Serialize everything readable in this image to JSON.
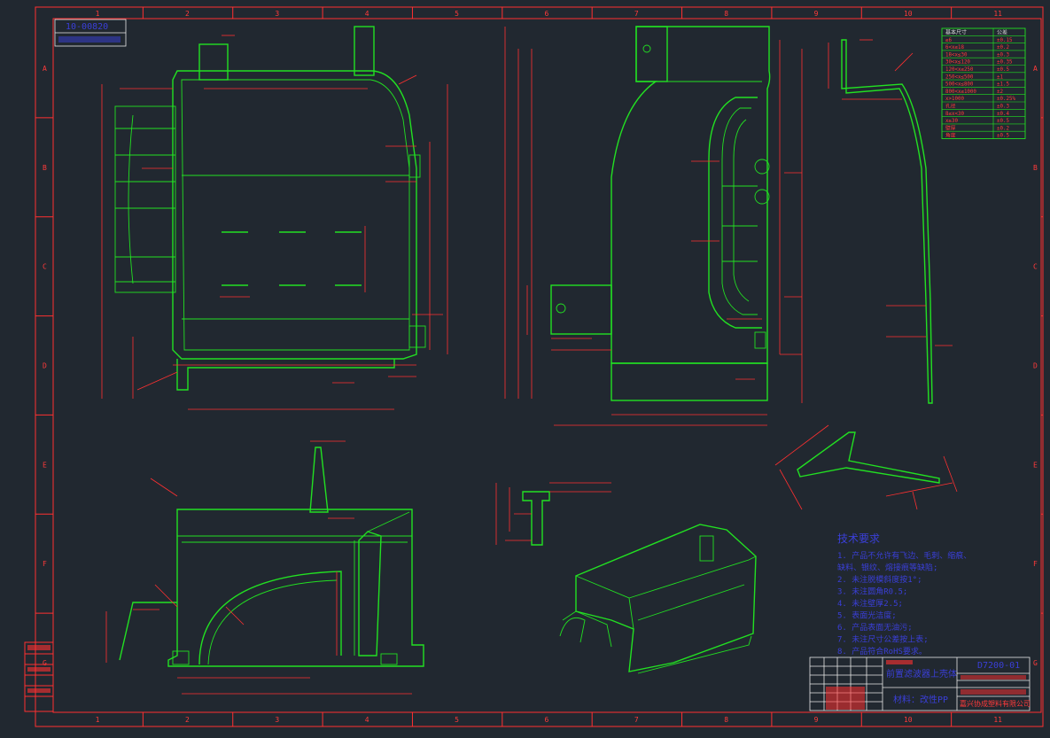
{
  "drawing": {
    "number_top": "10-00820",
    "title_block_code": "D7200-01",
    "title_block_part": "前置滤波器上壳体",
    "title_block_material": "材料：改性PP",
    "title_block_company": "嘉兴协成塑料有限公司"
  },
  "grid": {
    "columns": [
      "1",
      "2",
      "3",
      "4",
      "5",
      "6",
      "7",
      "8",
      "9",
      "10",
      "11"
    ],
    "rows": [
      "A",
      "B",
      "C",
      "D",
      "E",
      "F",
      "G"
    ]
  },
  "tolerance_table": {
    "header": [
      "基本尺寸",
      "公差"
    ],
    "rows": [
      [
        "≤6",
        "±0.15"
      ],
      [
        "6<x≤18",
        "±0.2"
      ],
      [
        "18<x≤30",
        "±0.3"
      ],
      [
        "30<x≤120",
        "±0.35"
      ],
      [
        "120<x≤250",
        "±0.5"
      ],
      [
        "250<x≤500",
        "±1"
      ],
      [
        "500<x≤800",
        "±1.5"
      ],
      [
        "800<x≤1000",
        "±2"
      ],
      [
        "x>1000",
        "±0.25%"
      ],
      [
        "孔径",
        "±0.3"
      ],
      [
        "8≤x<30",
        "±0.4"
      ],
      [
        "x≥30",
        "±0.5"
      ],
      [
        "壁厚",
        "±0.2"
      ],
      [
        "角度",
        "±0.5"
      ]
    ]
  },
  "tech_requirements": {
    "title": "技术要求",
    "lines": [
      "1. 产品不允许有飞边、毛刺、缩痕、",
      "   缺料、银纹、熔接痕等缺陷;",
      "2. 未注脱模斜度按1°;",
      "3. 未注圆角R0.5;",
      "4. 未注壁厚2.5;",
      "5. 表面光洁度;",
      "6. 产品表面无油污;",
      "7. 未注尺寸公差按上表;",
      "8. 产品符合RoHS要求。"
    ]
  }
}
